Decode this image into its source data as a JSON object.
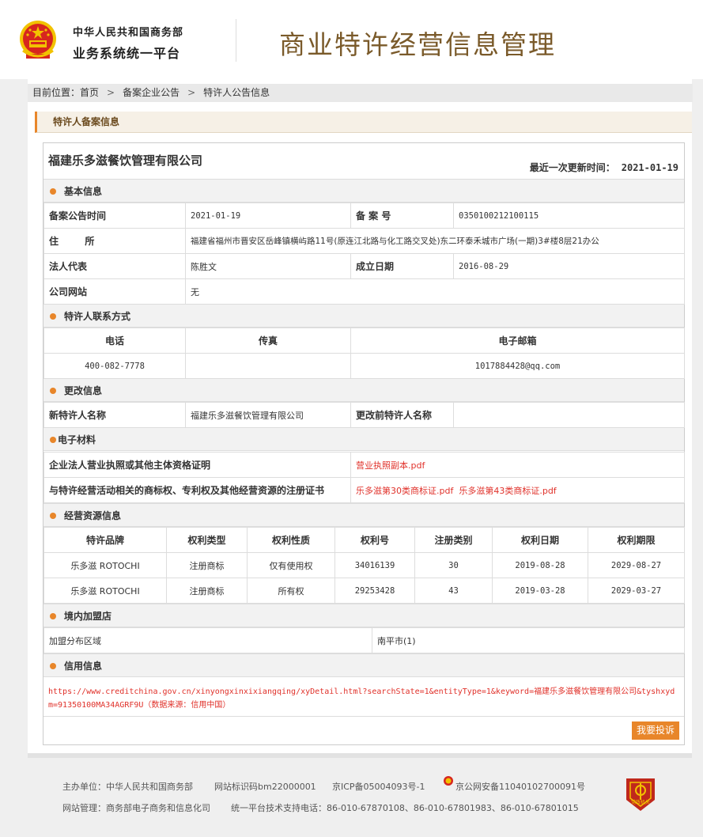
{
  "header": {
    "org_line1": "中华人民共和国商务部",
    "org_line2": "业务系统统一平台",
    "title": "商业特许经营信息管理"
  },
  "breadcrumb": {
    "prefix": "目前位置：",
    "items": [
      "首页",
      "备案企业公告",
      "特许人公告信息"
    ]
  },
  "section_title": "特许人备案信息",
  "company": {
    "name": "福建乐多滋餐饮管理有限公司",
    "updated_label": "最近一次更新时间：",
    "updated_value": "2021-01-19"
  },
  "basic": {
    "title": "基本信息",
    "filing_date_label": "备案公告时间",
    "filing_date": "2021-01-19",
    "filing_no_label": "备 案 号",
    "filing_no": "0350100212100115",
    "address_label": "住        所",
    "address": "福建省福州市晋安区岳峰镇横屿路11号(原连江北路与化工路交叉处)东二环泰禾城市广场(一期)3#楼8层21办公",
    "legal_rep_label": "法人代表",
    "legal_rep": "陈胜文",
    "est_date_label": "成立日期",
    "est_date": "2016-08-29",
    "website_label": "公司网站",
    "website": "无"
  },
  "contact": {
    "title": "特许人联系方式",
    "phone_label": "电话",
    "fax_label": "传真",
    "email_label": "电子邮箱",
    "phone": "400-082-7778",
    "fax": "",
    "email": "1017884428@qq.com"
  },
  "change": {
    "title": "更改信息",
    "new_name_label": "新特许人名称",
    "new_name": "福建乐多滋餐饮管理有限公司",
    "old_name_label": "更改前特许人名称",
    "old_name": ""
  },
  "materials": {
    "title": "电子材料",
    "license_label": "企业法人营业执照或其他主体资格证明",
    "license_file": "营业执照副本.pdf",
    "ip_label": "与特许经营活动相关的商标权、专利权及其他经营资源的注册证书",
    "ip_file1": "乐多滋第30类商标证.pdf",
    "ip_file2": "乐多滋第43类商标证.pdf"
  },
  "resources": {
    "title": "经营资源信息",
    "headers": [
      "特许品牌",
      "权利类型",
      "权利性质",
      "权利号",
      "注册类别",
      "权利日期",
      "权利期限"
    ],
    "rows": [
      [
        "乐多滋 ROTOCHI",
        "注册商标",
        "仅有使用权",
        "34016139",
        "30",
        "2019-08-28",
        "2029-08-27"
      ],
      [
        "乐多滋 ROTOCHI",
        "注册商标",
        "所有权",
        "29253428",
        "43",
        "2019-03-28",
        "2029-03-27"
      ]
    ]
  },
  "franchise": {
    "title": "境内加盟店",
    "area_label": "加盟分布区域",
    "area_value": "南平市(1)"
  },
  "credit": {
    "title": "信用信息",
    "url": "https://www.creditchina.gov.cn/xinyongxinxixiangqing/xyDetail.html?searchState=1&entityType=1&keyword=福建乐多滋餐饮管理有限公司&tyshxydm=91350100MA34AGRF9U",
    "source": "（数据来源：信用中国）",
    "complain_button": "我要投诉"
  },
  "footer": {
    "sponsor": "主办单位：中华人民共和国商务部",
    "site_id": "网站标识码bm22000001",
    "icp": "京ICP备05004093号-1",
    "police": "京公网安备11040102700091号",
    "admin": "网站管理：商务部电子商务和信息化司",
    "support": "统一平台技术支持电话：86-010-67870108、86-010-67801983、86-010-67801015",
    "badge_text": "党政机关"
  },
  "colors": {
    "accent": "#e8862a",
    "title_brown": "#7a5a2a",
    "link_red": "#e0312a",
    "emblem_red": "#d7261e",
    "emblem_gold": "#f2c200"
  }
}
